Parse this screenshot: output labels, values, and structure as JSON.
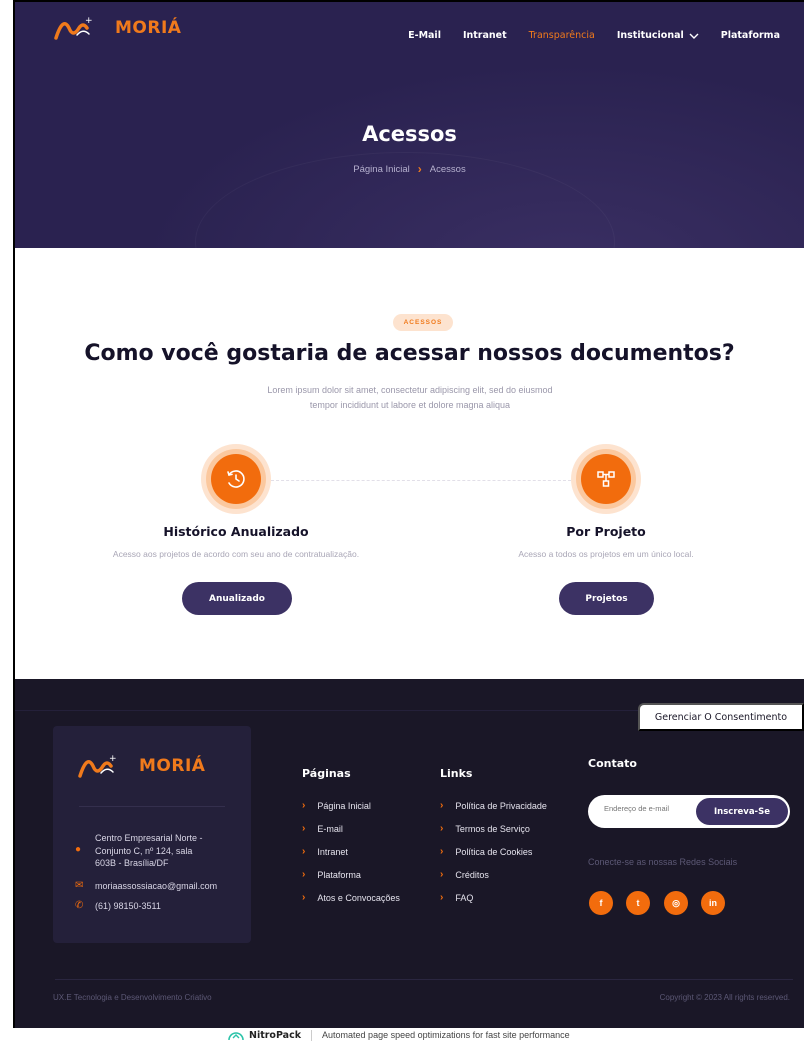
{
  "brand": {
    "name": "MORIÁ"
  },
  "nav": {
    "items": [
      {
        "label": "E-Mail",
        "active": false
      },
      {
        "label": "Intranet",
        "active": false
      },
      {
        "label": "Transparência",
        "active": true
      },
      {
        "label": "Institucional",
        "active": false,
        "dropdown": true
      },
      {
        "label": "Plataforma",
        "active": false
      }
    ]
  },
  "hero": {
    "title": "Acessos",
    "breadcrumb": {
      "home": "Página Inicial",
      "current": "Acessos"
    }
  },
  "main": {
    "badge": "ACESSOS",
    "title": "Como você gostaria de acessar nossos documentos?",
    "subtitle_line1": "Lorem ipsum dolor sit amet, consectetur adipiscing elit, sed do eiusmod",
    "subtitle_line2": "tempor incididunt ut labore et dolore magna aliqua",
    "cards": [
      {
        "icon": "history-icon",
        "title": "Histórico Anualizado",
        "description": "Acesso aos projetos de acordo com seu ano de contratualização.",
        "button": "Anualizado"
      },
      {
        "icon": "project-tree-icon",
        "title": "Por Projeto",
        "description": "Acesso a todos os projetos em um único local.",
        "button": "Projetos"
      }
    ]
  },
  "footer": {
    "consent_button": "Gerenciar O Consentimento",
    "address_lines": [
      "Centro Empresarial Norte -",
      "Conjunto C, nº 124, sala",
      "603B - Brasília/DF"
    ],
    "email": "moriaassossiacao@gmail.com",
    "phone": "(61) 98150-3511",
    "pages_title": "Páginas",
    "pages": [
      "Página Inicial",
      "E-mail",
      "Intranet",
      "Plataforma",
      "Atos e Convocações"
    ],
    "links_title": "Links",
    "links": [
      "Política de Privacidade",
      "Termos de Serviço",
      "Política de Cookies",
      "Créditos",
      "FAQ"
    ],
    "contact_title": "Contato",
    "newsletter_placeholder": "Endereço de e-mail",
    "newsletter_button": "Inscreva-Se",
    "social_caption": "Conecte-se as nossas Redes Sociais",
    "socials": [
      {
        "icon": "facebook-icon",
        "glyph": "f"
      },
      {
        "icon": "twitter-icon",
        "glyph": "t"
      },
      {
        "icon": "instagram-icon",
        "glyph": "◎"
      },
      {
        "icon": "linkedin-icon",
        "glyph": "in"
      }
    ],
    "credit": "UX.E Tecnologia e Desenvolvimento Criativo",
    "copyright": "Copyright © 2023 All rights reserved."
  },
  "nitropack": {
    "brand": "NitroPack",
    "text": "Automated page speed optimizations for fast site performance"
  },
  "colors": {
    "accent": "#f26c0d",
    "hero_bg": "#2a2250",
    "footer_bg": "#1a1727",
    "button_bg": "#3c3264"
  }
}
